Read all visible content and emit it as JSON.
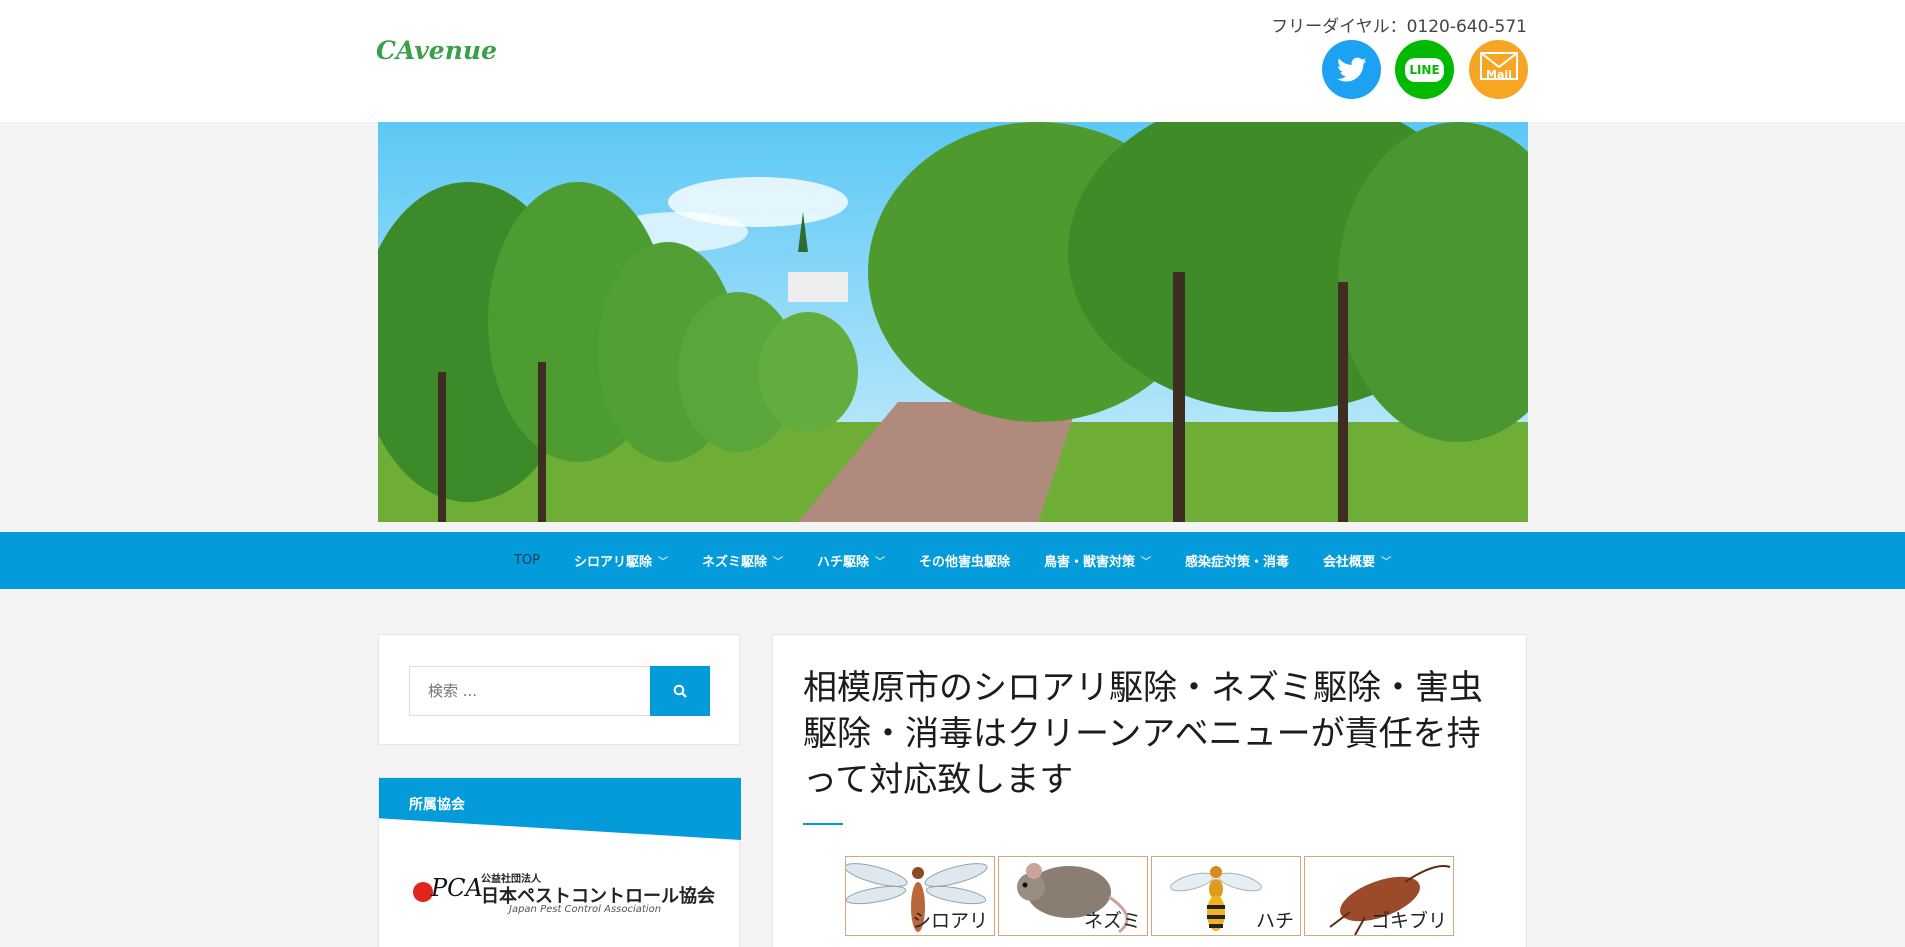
{
  "header": {
    "logo": "CAvenue",
    "phone": "フリーダイヤル：0120-640-571",
    "social": [
      {
        "name": "twitter-icon",
        "color": "#1da1f2"
      },
      {
        "name": "line-icon",
        "label": "LINE",
        "color": "#00b900"
      },
      {
        "name": "mail-icon",
        "label": "Mail",
        "color": "#f6a623"
      }
    ]
  },
  "nav": {
    "items": [
      {
        "label": "TOP"
      },
      {
        "label": "シロアリ駆除"
      },
      {
        "label": "ネズミ駆除"
      },
      {
        "label": "ハチ駆除"
      },
      {
        "label": "その他害虫駆除"
      },
      {
        "label": "鳥害・獣害対策"
      },
      {
        "label": "感染症対策・消毒"
      },
      {
        "label": "会社概要"
      }
    ],
    "accent": "#039bd9"
  },
  "sidebar": {
    "search": {
      "placeholder": "検索 ..."
    },
    "association": {
      "heading": "所属協会",
      "org_small": "公益社団法人",
      "org_name": "日本ペストコントロール協会",
      "org_en": "Japan Pest Control Association",
      "org_abbr": "PCA"
    }
  },
  "main": {
    "title": "相模原市のシロアリ駆除・ネズミ駆除・害虫駆除・消毒はクリーンアベニューが責任を持って対応致します",
    "pests": [
      {
        "label": "シロアリ"
      },
      {
        "label": "ネズミ"
      },
      {
        "label": "ハチ"
      },
      {
        "label": "ゴキブリ"
      }
    ]
  }
}
